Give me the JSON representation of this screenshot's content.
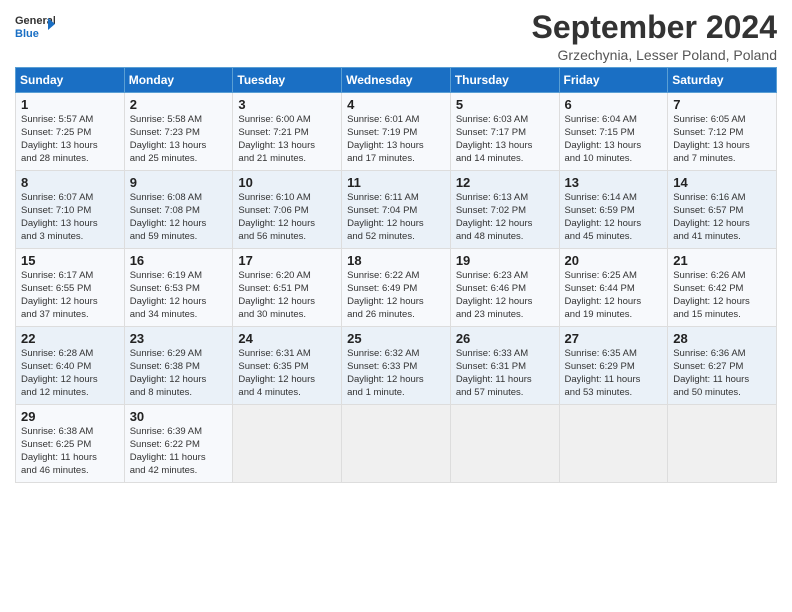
{
  "header": {
    "logo_general": "General",
    "logo_blue": "Blue",
    "month": "September 2024",
    "location": "Grzechynia, Lesser Poland, Poland"
  },
  "weekdays": [
    "Sunday",
    "Monday",
    "Tuesday",
    "Wednesday",
    "Thursday",
    "Friday",
    "Saturday"
  ],
  "weeks": [
    [
      {
        "day": "1",
        "lines": [
          "Sunrise: 5:57 AM",
          "Sunset: 7:25 PM",
          "Daylight: 13 hours",
          "and 28 minutes."
        ]
      },
      {
        "day": "2",
        "lines": [
          "Sunrise: 5:58 AM",
          "Sunset: 7:23 PM",
          "Daylight: 13 hours",
          "and 25 minutes."
        ]
      },
      {
        "day": "3",
        "lines": [
          "Sunrise: 6:00 AM",
          "Sunset: 7:21 PM",
          "Daylight: 13 hours",
          "and 21 minutes."
        ]
      },
      {
        "day": "4",
        "lines": [
          "Sunrise: 6:01 AM",
          "Sunset: 7:19 PM",
          "Daylight: 13 hours",
          "and 17 minutes."
        ]
      },
      {
        "day": "5",
        "lines": [
          "Sunrise: 6:03 AM",
          "Sunset: 7:17 PM",
          "Daylight: 13 hours",
          "and 14 minutes."
        ]
      },
      {
        "day": "6",
        "lines": [
          "Sunrise: 6:04 AM",
          "Sunset: 7:15 PM",
          "Daylight: 13 hours",
          "and 10 minutes."
        ]
      },
      {
        "day": "7",
        "lines": [
          "Sunrise: 6:05 AM",
          "Sunset: 7:12 PM",
          "Daylight: 13 hours",
          "and 7 minutes."
        ]
      }
    ],
    [
      {
        "day": "8",
        "lines": [
          "Sunrise: 6:07 AM",
          "Sunset: 7:10 PM",
          "Daylight: 13 hours",
          "and 3 minutes."
        ]
      },
      {
        "day": "9",
        "lines": [
          "Sunrise: 6:08 AM",
          "Sunset: 7:08 PM",
          "Daylight: 12 hours",
          "and 59 minutes."
        ]
      },
      {
        "day": "10",
        "lines": [
          "Sunrise: 6:10 AM",
          "Sunset: 7:06 PM",
          "Daylight: 12 hours",
          "and 56 minutes."
        ]
      },
      {
        "day": "11",
        "lines": [
          "Sunrise: 6:11 AM",
          "Sunset: 7:04 PM",
          "Daylight: 12 hours",
          "and 52 minutes."
        ]
      },
      {
        "day": "12",
        "lines": [
          "Sunrise: 6:13 AM",
          "Sunset: 7:02 PM",
          "Daylight: 12 hours",
          "and 48 minutes."
        ]
      },
      {
        "day": "13",
        "lines": [
          "Sunrise: 6:14 AM",
          "Sunset: 6:59 PM",
          "Daylight: 12 hours",
          "and 45 minutes."
        ]
      },
      {
        "day": "14",
        "lines": [
          "Sunrise: 6:16 AM",
          "Sunset: 6:57 PM",
          "Daylight: 12 hours",
          "and 41 minutes."
        ]
      }
    ],
    [
      {
        "day": "15",
        "lines": [
          "Sunrise: 6:17 AM",
          "Sunset: 6:55 PM",
          "Daylight: 12 hours",
          "and 37 minutes."
        ]
      },
      {
        "day": "16",
        "lines": [
          "Sunrise: 6:19 AM",
          "Sunset: 6:53 PM",
          "Daylight: 12 hours",
          "and 34 minutes."
        ]
      },
      {
        "day": "17",
        "lines": [
          "Sunrise: 6:20 AM",
          "Sunset: 6:51 PM",
          "Daylight: 12 hours",
          "and 30 minutes."
        ]
      },
      {
        "day": "18",
        "lines": [
          "Sunrise: 6:22 AM",
          "Sunset: 6:49 PM",
          "Daylight: 12 hours",
          "and 26 minutes."
        ]
      },
      {
        "day": "19",
        "lines": [
          "Sunrise: 6:23 AM",
          "Sunset: 6:46 PM",
          "Daylight: 12 hours",
          "and 23 minutes."
        ]
      },
      {
        "day": "20",
        "lines": [
          "Sunrise: 6:25 AM",
          "Sunset: 6:44 PM",
          "Daylight: 12 hours",
          "and 19 minutes."
        ]
      },
      {
        "day": "21",
        "lines": [
          "Sunrise: 6:26 AM",
          "Sunset: 6:42 PM",
          "Daylight: 12 hours",
          "and 15 minutes."
        ]
      }
    ],
    [
      {
        "day": "22",
        "lines": [
          "Sunrise: 6:28 AM",
          "Sunset: 6:40 PM",
          "Daylight: 12 hours",
          "and 12 minutes."
        ]
      },
      {
        "day": "23",
        "lines": [
          "Sunrise: 6:29 AM",
          "Sunset: 6:38 PM",
          "Daylight: 12 hours",
          "and 8 minutes."
        ]
      },
      {
        "day": "24",
        "lines": [
          "Sunrise: 6:31 AM",
          "Sunset: 6:35 PM",
          "Daylight: 12 hours",
          "and 4 minutes."
        ]
      },
      {
        "day": "25",
        "lines": [
          "Sunrise: 6:32 AM",
          "Sunset: 6:33 PM",
          "Daylight: 12 hours",
          "and 1 minute."
        ]
      },
      {
        "day": "26",
        "lines": [
          "Sunrise: 6:33 AM",
          "Sunset: 6:31 PM",
          "Daylight: 11 hours",
          "and 57 minutes."
        ]
      },
      {
        "day": "27",
        "lines": [
          "Sunrise: 6:35 AM",
          "Sunset: 6:29 PM",
          "Daylight: 11 hours",
          "and 53 minutes."
        ]
      },
      {
        "day": "28",
        "lines": [
          "Sunrise: 6:36 AM",
          "Sunset: 6:27 PM",
          "Daylight: 11 hours",
          "and 50 minutes."
        ]
      }
    ],
    [
      {
        "day": "29",
        "lines": [
          "Sunrise: 6:38 AM",
          "Sunset: 6:25 PM",
          "Daylight: 11 hours",
          "and 46 minutes."
        ]
      },
      {
        "day": "30",
        "lines": [
          "Sunrise: 6:39 AM",
          "Sunset: 6:22 PM",
          "Daylight: 11 hours",
          "and 42 minutes."
        ]
      },
      {
        "day": "",
        "lines": []
      },
      {
        "day": "",
        "lines": []
      },
      {
        "day": "",
        "lines": []
      },
      {
        "day": "",
        "lines": []
      },
      {
        "day": "",
        "lines": []
      }
    ]
  ]
}
